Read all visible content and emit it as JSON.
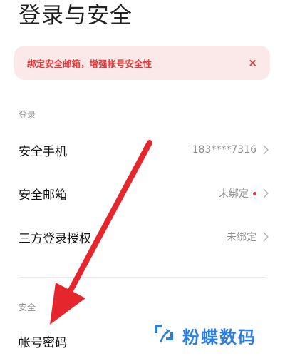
{
  "page": {
    "title": "登录与安全"
  },
  "banner": {
    "text": "绑定安全邮箱，增强帐号安全性",
    "close_glyph": "×",
    "color": "#e0393a",
    "background": "#fbe8e8"
  },
  "sections": {
    "login": {
      "label": "登录",
      "rows": [
        {
          "label": "安全手机",
          "value": "183****7316"
        },
        {
          "label": "安全邮箱",
          "value": "未绑定",
          "badge": "red-dot"
        },
        {
          "label": "三方登录授权",
          "value": "未绑定"
        }
      ]
    },
    "security": {
      "label": "安全",
      "rows": [
        {
          "label": "帐号密码"
        }
      ]
    }
  },
  "annotation": {
    "arrow_color": "#e5262c"
  },
  "watermark": {
    "text": "粉蝶数码",
    "color": "#2d7fdf",
    "icon": "brand-logo-icon"
  }
}
